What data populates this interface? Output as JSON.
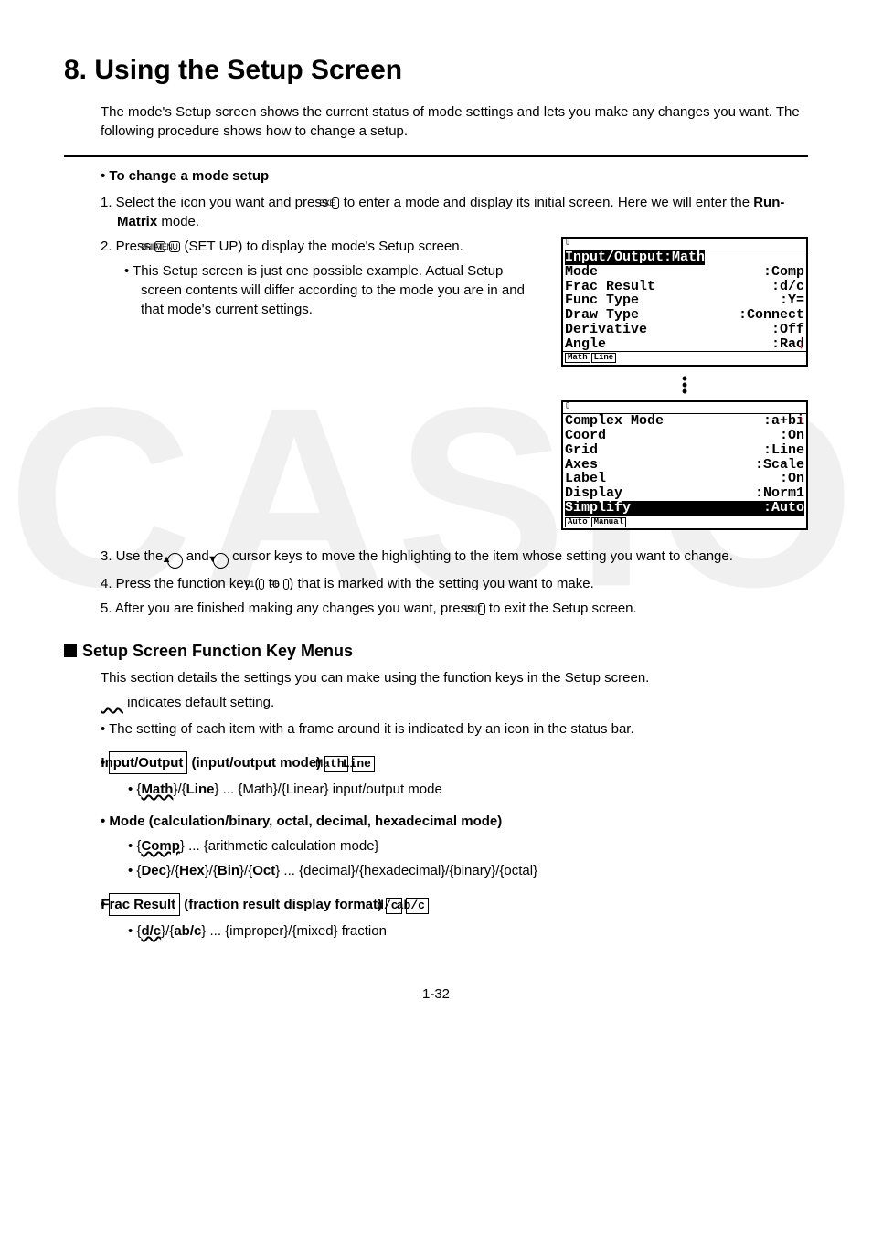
{
  "title": "8. Using the Setup Screen",
  "intro": "The mode's Setup screen shows the current status of mode settings and lets you make any changes you want. The following procedure shows how to change a setup.",
  "proc_heading_prefix": "• ",
  "proc_heading": "To change a mode setup",
  "step1a": "1. Select the icon you want and press ",
  "key_exe": "EXE",
  "step1b": " to enter a mode and display its initial screen. Here we will enter the ",
  "step1_bold": "Run-Matrix",
  "step1c": " mode.",
  "step2a": "2. Press ",
  "key_shift": "SHIFT",
  "key_menu": "MENU",
  "step2b": " (SET UP) to display the mode's Setup screen.",
  "step2_note": "• This Setup screen is just one possible example. Actual Setup screen contents will differ according to the mode you are in and that mode's current settings.",
  "calc1": {
    "highlight": "Input/Output:Math",
    "rows": [
      [
        "Mode",
        ":Comp"
      ],
      [
        "Frac Result",
        ":d/c"
      ],
      [
        "Func Type",
        ":Y="
      ],
      [
        "Draw Type",
        ":Connect"
      ],
      [
        "Derivative",
        ":Off"
      ],
      [
        "Angle",
        ":Rad"
      ]
    ],
    "fkeys": [
      "Math",
      "Line"
    ],
    "arrow": "↓"
  },
  "calc2": {
    "rows": [
      [
        "Complex Mode",
        ":a+bi"
      ],
      [
        "Coord",
        ":On"
      ],
      [
        "Grid",
        ":Line"
      ],
      [
        "Axes",
        ":Scale"
      ],
      [
        "Label",
        ":On"
      ],
      [
        "Display",
        ":Norm1"
      ]
    ],
    "highlight_row": [
      "Simplify",
      ":Auto"
    ],
    "fkeys": [
      "Auto",
      "Manual"
    ],
    "arrow": "↑"
  },
  "step3a": "3. Use the ",
  "step3b": " and ",
  "step3c": " cursor keys to move the highlighting to the item whose setting you want to change.",
  "step4a": "4. Press the function key (",
  "key_f1": "F1",
  "step4b": " to ",
  "key_f6": "F6",
  "step4c": ") that is marked with the setting you want to make.",
  "step5a": "5. After you are finished making any changes you want, press ",
  "key_exit": "EXIT",
  "step5b": " to exit the Setup screen.",
  "section2_title": "Setup Screen Function Key Menus",
  "section2_p1": "This section details the settings you can make using the function keys in the Setup screen.",
  "section2_p2": " indicates default setting.",
  "section2_p3": "• The setting of each item with a frame around it is indicated by an icon in the status bar.",
  "item1_box": "Input/Output",
  "item1_label": " (input/output mode) ",
  "item1_icon1": "Math",
  "item1_icon2": "Line",
  "item1_sub_a": "• {",
  "item1_sub_math": "Math",
  "item1_sub_b": "}/{",
  "item1_sub_line": "Line",
  "item1_sub_c": "} ... {Math}/{Linear} input/output mode",
  "item2_label": "• Mode (calculation/binary, octal, decimal, hexadecimal mode)",
  "item2_sub1_a": "• {",
  "item2_sub1_comp": "Comp",
  "item2_sub1_b": "} ... {arithmetic calculation mode}",
  "item2_sub2": "• {Dec}/{Hex}/{Bin}/{Oct} ... {decimal}/{hexadecimal}/{binary}/{octal}",
  "item2_sub2_a": "• {",
  "item2_dec": "Dec",
  "item2_sl1": "}/{",
  "item2_hex": "Hex",
  "item2_sl2": "}/{",
  "item2_bin": "Bin",
  "item2_sl3": "}/{",
  "item2_oct": "Oct",
  "item2_tail": "} ... {decimal}/{hexadecimal}/{binary}/{octal}",
  "item3_box": "Frac Result",
  "item3_label": " (fraction result display format) ",
  "item3_icon1": "d/c",
  "item3_icon2": "ab/c",
  "item3_sub_a": "• {",
  "item3_dc": "d/c",
  "item3_sub_b": "}/{",
  "item3_abc": "ab/c",
  "item3_sub_c": "} ... {improper}/{mixed} fraction",
  "pagenum": "1-32"
}
